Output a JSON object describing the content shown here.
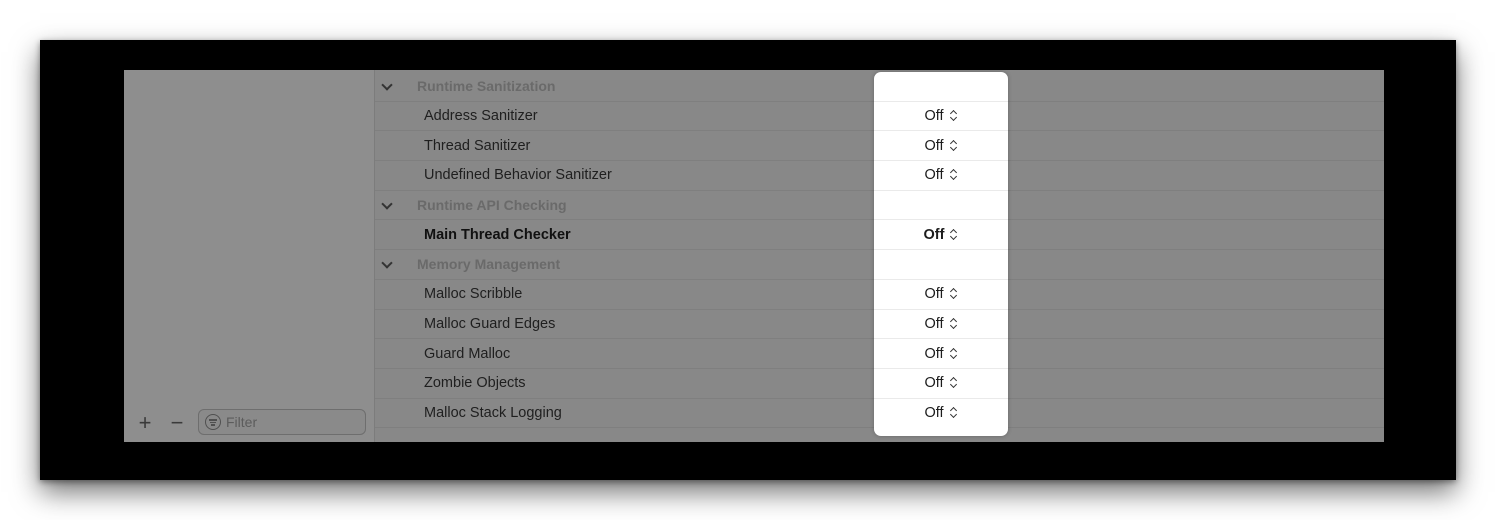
{
  "sidebar": {
    "add_label": "+",
    "remove_label": "−",
    "filter_placeholder": "Filter"
  },
  "rows": [
    {
      "type": "section",
      "label": "Runtime Sanitization"
    },
    {
      "type": "item",
      "label": "Address Sanitizer",
      "value": "Off"
    },
    {
      "type": "item",
      "label": "Thread Sanitizer",
      "value": "Off"
    },
    {
      "type": "item",
      "label": "Undefined Behavior Sanitizer",
      "value": "Off"
    },
    {
      "type": "section",
      "label": "Runtime API Checking"
    },
    {
      "type": "item",
      "label": "Main Thread Checker",
      "value": "Off",
      "bold": true
    },
    {
      "type": "section",
      "label": "Memory Management"
    },
    {
      "type": "item",
      "label": "Malloc Scribble",
      "value": "Off"
    },
    {
      "type": "item",
      "label": "Malloc Guard Edges",
      "value": "Off"
    },
    {
      "type": "item",
      "label": "Guard Malloc",
      "value": "Off"
    },
    {
      "type": "item",
      "label": "Zombie Objects",
      "value": "Off"
    },
    {
      "type": "item",
      "label": "Malloc Stack Logging",
      "value": "Off"
    }
  ]
}
